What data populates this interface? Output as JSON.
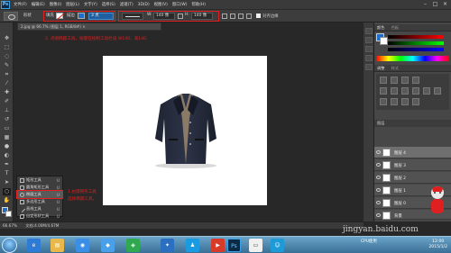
{
  "app": {
    "logo": "Ps",
    "menus": [
      "文件(F)",
      "编辑(E)",
      "图像(I)",
      "图层(L)",
      "文字(Y)",
      "选择(S)",
      "滤镜(T)",
      "3D(D)",
      "视图(V)",
      "窗口(W)",
      "帮助(H)"
    ],
    "window_buttons": [
      "–",
      "□",
      "×"
    ]
  },
  "options_bar": {
    "shape_mode": "形状",
    "fill_label": "填充",
    "stroke_label": "描边",
    "stroke_width": "3 点",
    "w_label": "W:",
    "w_value": "140 像",
    "h_label": "H:",
    "h_value": "140 像",
    "align_edges_label": "对齐边缘"
  },
  "document_tab": "2.jpg @ 66.7% (图层 1, RGB/8#) ×",
  "annotations": {
    "top": "2. 点缀椭圆工具，按键在绘制工具栏设 W140，高140.",
    "side_line1": "1.右键矩形工具",
    "side_line2": "选择椭圆工具。"
  },
  "flyout": [
    {
      "label": "矩形工具",
      "key": "U",
      "selected": false
    },
    {
      "label": "圆角矩形工具",
      "key": "U",
      "selected": false
    },
    {
      "label": "椭圆工具",
      "key": "U",
      "selected": true
    },
    {
      "label": "多边形工具",
      "key": "U",
      "selected": false
    },
    {
      "label": "直线工具",
      "key": "U",
      "selected": false
    },
    {
      "label": "自定形状工具",
      "key": "U",
      "selected": false
    }
  ],
  "panels": {
    "color_tab": "颜色",
    "swatches_tab": "色板",
    "adjust_tab": "调整",
    "styles_tab": "样式",
    "layers_tab": "图层"
  },
  "layers": [
    {
      "name": "图层 4",
      "selected": true
    },
    {
      "name": "图层 3",
      "selected": false
    },
    {
      "name": "图层 2",
      "selected": false
    },
    {
      "name": "图层 1",
      "selected": false
    },
    {
      "name": "图层 0",
      "selected": false
    },
    {
      "name": "背景",
      "selected": false
    }
  ],
  "status": {
    "zoom": "66.67%",
    "doc": "文档:4.00M/4.67M"
  },
  "taskbar": {
    "tray_text": "CPU使用",
    "clock_time": "12:00",
    "clock_date": "2015/1/2"
  },
  "watermark": "jingyan.baidu.com",
  "colors": {
    "annotation_red": "#e02020",
    "accent_blue": "#1e6ec8"
  }
}
